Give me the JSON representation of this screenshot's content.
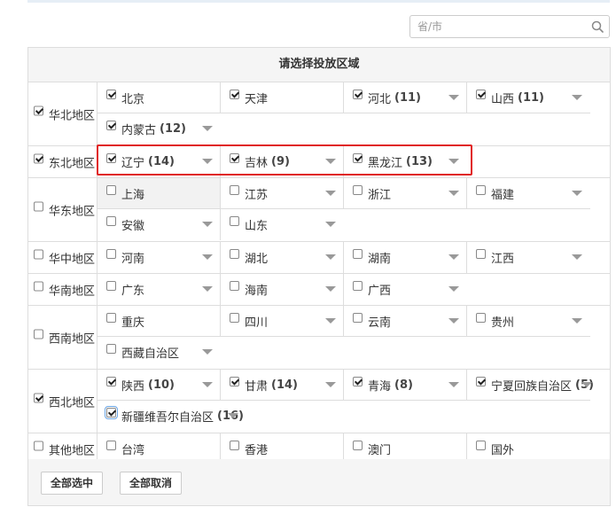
{
  "search": {
    "placeholder": "省/市",
    "value": ""
  },
  "panel_title": "请选择投放区域",
  "regions": {
    "north": {
      "label": "华北地区",
      "checked": true,
      "provinces": [
        {
          "name": "北京",
          "count": "",
          "checked": true
        },
        {
          "name": "天津",
          "count": "",
          "checked": true
        },
        {
          "name": "河北",
          "count": "(11)",
          "checked": true
        },
        {
          "name": "山西",
          "count": "(11)",
          "checked": true
        },
        {
          "name": "内蒙古",
          "count": "(12)",
          "checked": true
        }
      ]
    },
    "northeast": {
      "label": "东北地区",
      "checked": true,
      "provinces": [
        {
          "name": "辽宁",
          "count": "(14)",
          "checked": true
        },
        {
          "name": "吉林",
          "count": "(9)",
          "checked": true
        },
        {
          "name": "黑龙江",
          "count": "(13)",
          "checked": true
        }
      ]
    },
    "east": {
      "label": "华东地区",
      "checked": false,
      "provinces": [
        {
          "name": "上海",
          "count": "",
          "checked": false
        },
        {
          "name": "江苏",
          "count": "",
          "checked": false
        },
        {
          "name": "浙江",
          "count": "",
          "checked": false
        },
        {
          "name": "福建",
          "count": "",
          "checked": false
        },
        {
          "name": "安徽",
          "count": "",
          "checked": false
        },
        {
          "name": "山东",
          "count": "",
          "checked": false
        }
      ]
    },
    "central": {
      "label": "华中地区",
      "checked": false,
      "provinces": [
        {
          "name": "河南",
          "count": "",
          "checked": false
        },
        {
          "name": "湖北",
          "count": "",
          "checked": false
        },
        {
          "name": "湖南",
          "count": "",
          "checked": false
        },
        {
          "name": "江西",
          "count": "",
          "checked": false
        }
      ]
    },
    "south": {
      "label": "华南地区",
      "checked": false,
      "provinces": [
        {
          "name": "广东",
          "count": "",
          "checked": false
        },
        {
          "name": "海南",
          "count": "",
          "checked": false
        },
        {
          "name": "广西",
          "count": "",
          "checked": false
        }
      ]
    },
    "southwest": {
      "label": "西南地区",
      "checked": false,
      "provinces": [
        {
          "name": "重庆",
          "count": "",
          "checked": false
        },
        {
          "name": "四川",
          "count": "",
          "checked": false
        },
        {
          "name": "云南",
          "count": "",
          "checked": false
        },
        {
          "name": "贵州",
          "count": "",
          "checked": false
        },
        {
          "name": "西藏自治区",
          "count": "",
          "checked": false
        }
      ]
    },
    "northwest": {
      "label": "西北地区",
      "checked": true,
      "provinces": [
        {
          "name": "陕西",
          "count": "(10)",
          "checked": true
        },
        {
          "name": "甘肃",
          "count": "(14)",
          "checked": true
        },
        {
          "name": "青海",
          "count": "(8)",
          "checked": true
        },
        {
          "name": "宁夏回族自治区",
          "count": "(5)",
          "checked": true
        },
        {
          "name": "新疆维吾尔自治区",
          "count": "(16)",
          "checked": true
        }
      ]
    },
    "other": {
      "label": "其他地区",
      "checked": false,
      "provinces": [
        {
          "name": "台湾",
          "count": "",
          "checked": false
        },
        {
          "name": "香港",
          "count": "",
          "checked": false
        },
        {
          "name": "澳门",
          "count": "",
          "checked": false
        },
        {
          "name": "国外",
          "count": "",
          "checked": false
        }
      ]
    }
  },
  "buttons": {
    "select_all": "全部选中",
    "deselect_all": "全部取消"
  },
  "colors": {
    "highlight": "#e02020",
    "header_bg": "#f5f5f5",
    "border": "#dddddd"
  }
}
